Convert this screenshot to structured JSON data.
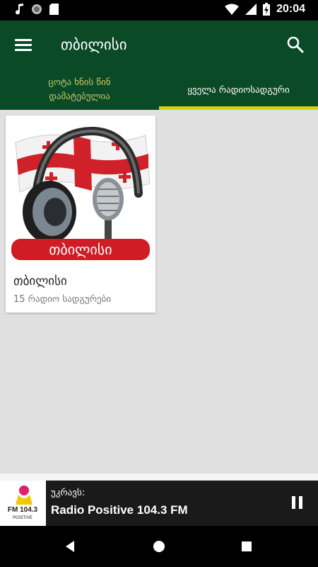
{
  "status_bar": {
    "time": "20:04",
    "icons": [
      "music-note-icon",
      "circle-icon",
      "sd-card-icon",
      "wifi-icon",
      "signal-icon",
      "battery-charging-icon"
    ]
  },
  "toolbar": {
    "title": "თბილისი",
    "menu_icon": "hamburger-menu-icon",
    "search_icon": "search-icon"
  },
  "tabs": [
    {
      "label_line1": "ცოტა ხნის წინ",
      "label_line2": "დამატებულია",
      "selected": false
    },
    {
      "label": "ყველა რადიოსადგური",
      "selected": true
    }
  ],
  "colors": {
    "toolbar": "#0a4a27",
    "tab_indicator": "#d4d40a",
    "inactive_tab_text": "#c8c86a",
    "player_bg": "#1a1a1a"
  },
  "cards": [
    {
      "title": "თბილისი",
      "subtitle": "15 რადიო სადგურები",
      "image_banner_text": "თბილისი"
    }
  ],
  "player": {
    "label": "უკრავს:",
    "station": "Radio Positive 104.3 FM",
    "logo_text_line1": "FM 104.3",
    "logo_text_line2": "POSITIVE",
    "state_icon": "pause-icon"
  },
  "nav": {
    "icons": [
      "back-icon",
      "home-icon",
      "recents-icon"
    ]
  }
}
